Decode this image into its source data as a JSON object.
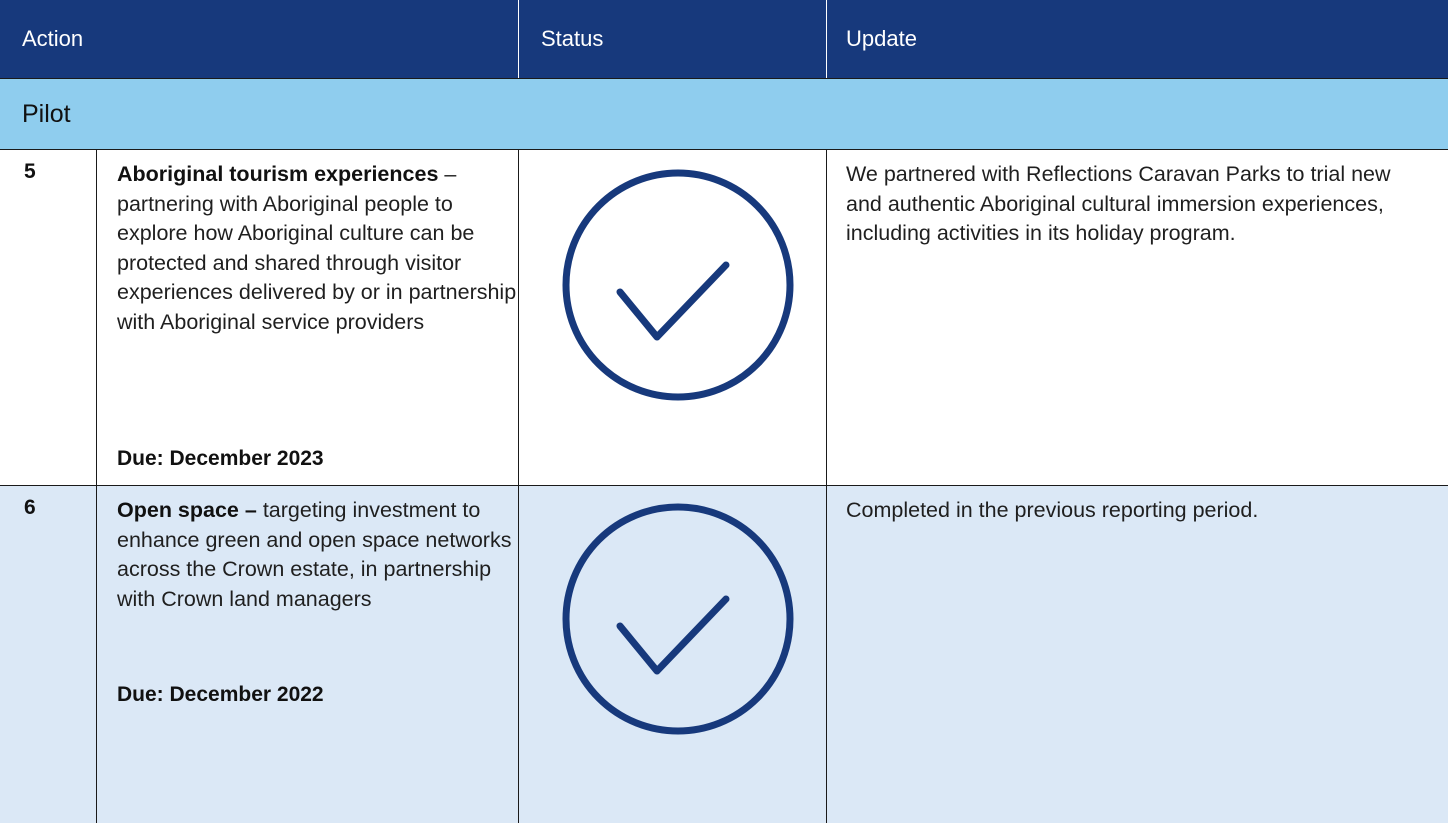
{
  "header": {
    "action_label": "Action",
    "status_label": "Status",
    "update_label": "Update"
  },
  "section": {
    "title": "Pilot"
  },
  "rows": [
    {
      "number": "5",
      "action_title": "Aboriginal tourism experiences",
      "action_body": "– partnering with Aboriginal people to explore how Aboriginal culture can be protected and shared through visitor experiences delivered by or in partnership with Aboriginal service providers",
      "due": "Due: December 2023",
      "status_icon": "check-circle-icon",
      "update": "We partnered with Reflections Caravan Parks to trial new and authentic Aboriginal cultural immersion experiences, including activities in its holiday program."
    },
    {
      "number": "6",
      "action_title": "Open space –",
      "action_body": "targeting investment to enhance green and open space networks across the Crown estate, in partnership with Crown land managers",
      "due": "Due: December 2022",
      "status_icon": "check-circle-icon",
      "update": "Completed in the previous reporting period."
    }
  ],
  "colors": {
    "header_bg": "#17397c",
    "section_bg": "#8fcdee",
    "alt_row_bg": "#dbe8f6",
    "icon_color": "#17397c"
  }
}
